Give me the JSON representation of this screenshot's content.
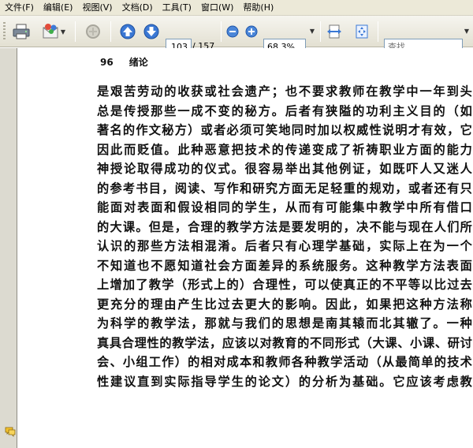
{
  "menu": {
    "items": [
      "文件(F)",
      "编辑(E)",
      "视图(V)",
      "文档(D)",
      "工具(T)",
      "窗口(W)",
      "帮助(H)"
    ]
  },
  "toolbar": {
    "icons": [
      "print-icon",
      "email-icon",
      "disabled-tool-icon",
      "previous-page-icon",
      "next-page-icon",
      "zoom-out-icon",
      "zoom-in-icon",
      "fit-width-icon",
      "fit-page-icon"
    ],
    "page_current": "103",
    "page_total": "/ 157",
    "zoom": "68.3%",
    "search_placeholder": "查找"
  },
  "document": {
    "page_number": "96",
    "chapter": "绪论",
    "lines": [
      "是艰苦劳动的收获或社会遗产；也不要求教师在教学中一年到头",
      "总是传授那些一成不变的秘方。后者有狭隘的功利主义目的（如",
      "著名的作文秘方）或者必须可笑地同时加以权威性说明才有效，它",
      "因此而贬值。此种恶意把技术的传递变成了祈祷职业方面的能力",
      "神授论取得成功的仪式。很容易举出其他例证，如既吓人又迷人",
      "的参考书目，阅读、写作和研究方面无足轻重的规劝，或者还有只",
      "能面对表面和假设相同的学生，从而有可能集中教学中所有借口",
      "的大课。但是，合理的教学方法是要发明的，决不能与现在人们所",
      "认识的那些方法相混淆。后者只有心理学基础，实际上在为一个",
      "不知道也不愿知道社会方面差异的系统服务。这种教学方法表面",
      "上增加了教学（形式上的）合理性，可以使真正的不平等以比过去",
      "更充分的理由产生比过去更大的影响。因此，如果把这种方法称",
      "为科学的教学法，那就与我们的思想是南其辕而北其辙了。一种",
      "真具合理性的教学法，应该以对教育的不同形式（大课、小课、研讨",
      "会、小组工作）的相对成本和教师各种教学活动（从最简单的技术",
      "性建议直到实际指导学生的论文）的分析为基础。它应该考虑教"
    ]
  }
}
